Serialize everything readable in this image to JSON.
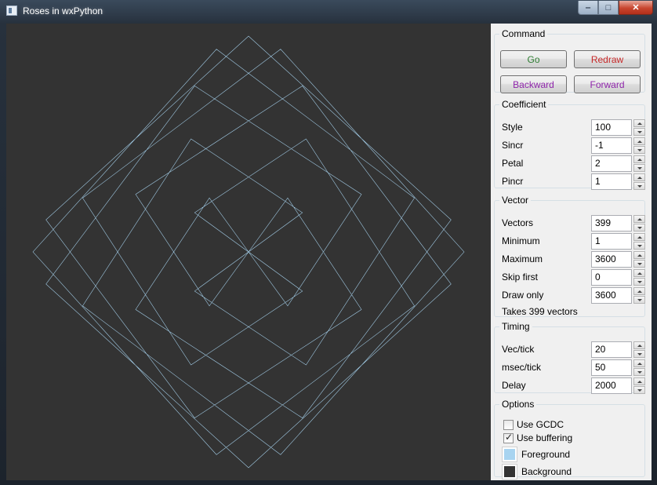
{
  "window": {
    "title": "Roses in wxPython",
    "minimize_glyph": "‒",
    "maximize_glyph": "□",
    "close_glyph": "✕"
  },
  "canvas": {
    "background": "#333333",
    "foreground": "#a8d4f0"
  },
  "command": {
    "legend": "Command",
    "go": "Go",
    "redraw": "Redraw",
    "backward": "Backward",
    "forward": "Forward",
    "go_color": "#2e7d32",
    "redraw_color": "#c62828",
    "backward_color": "#8e24aa",
    "forward_color": "#8e24aa"
  },
  "coefficient": {
    "legend": "Coefficient",
    "rows": [
      {
        "label": "Style",
        "value": "100"
      },
      {
        "label": "Sincr",
        "value": "-1"
      },
      {
        "label": "Petal",
        "value": "2"
      },
      {
        "label": "Pincr",
        "value": "1"
      }
    ]
  },
  "vector": {
    "legend": "Vector",
    "rows": [
      {
        "label": "Vectors",
        "value": "399"
      },
      {
        "label": "Minimum",
        "value": "1"
      },
      {
        "label": "Maximum",
        "value": "3600"
      },
      {
        "label": "Skip first",
        "value": "0"
      },
      {
        "label": "Draw only",
        "value": "3600"
      }
    ],
    "info": "Takes 399 vectors"
  },
  "timing": {
    "legend": "Timing",
    "rows": [
      {
        "label": "Vec/tick",
        "value": "20"
      },
      {
        "label": "msec/tick",
        "value": "50"
      },
      {
        "label": "Delay",
        "value": "2000"
      }
    ]
  },
  "options": {
    "legend": "Options",
    "use_gcdc": {
      "label": "Use GCDC",
      "checked": false
    },
    "use_buffering": {
      "label": "Use buffering",
      "checked": true,
      "mark": "✓"
    },
    "foreground": {
      "label": "Foreground",
      "color": "#a8d4f0"
    },
    "background": {
      "label": "Background",
      "color": "#333333"
    }
  }
}
